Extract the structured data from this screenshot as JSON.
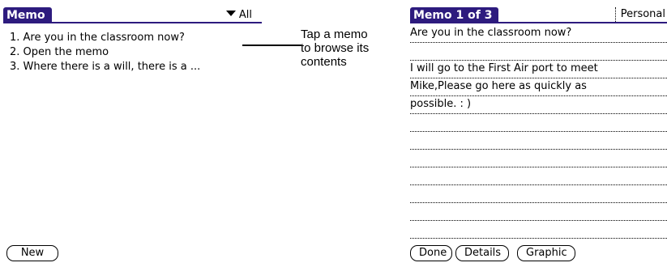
{
  "left_screen": {
    "title": "Memo",
    "category": "All",
    "memos": [
      "1. Are  you in the classroom now?",
      "2. Open the memo",
      "3. Where there is a will, there is a ..."
    ],
    "new_button": "New"
  },
  "annotation": {
    "lines": [
      "Tap a memo",
      "to browse its",
      "contents"
    ]
  },
  "right_screen": {
    "title": "Memo 1 of 3",
    "category": "Personal",
    "lines": [
      "Are  you in the classroom now?",
      "",
      "I will go to the First Air port  to meet",
      "Mike,Please go here as quickly as",
      "possible. : )",
      "",
      "",
      "",
      "",
      "",
      "",
      ""
    ],
    "done_button": "Done",
    "details_button": "Details",
    "graphic_button": "Graphic"
  },
  "colors": {
    "title_bar": "#2d1b7e"
  }
}
